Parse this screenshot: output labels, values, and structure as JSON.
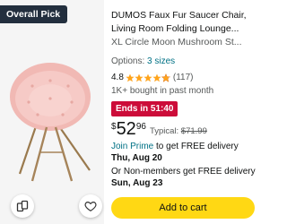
{
  "badge": {
    "label": "Overall Pick"
  },
  "product": {
    "title_line1": "DUMOS Faux Fur Saucer Chair,",
    "title_line2": "Living Room Folding Lounge...",
    "title_line3": "XL Circle Moon Mushroom St...",
    "options_prefix": "Options:",
    "options_link": "3 sizes",
    "rating": "4.8",
    "rating_value": 4.8,
    "review_count": "(117)",
    "bought": "1K+ bought in past month",
    "deal": "Ends in 51:40",
    "price_symbol": "$",
    "price_whole": "52",
    "price_fraction": "96",
    "typical_label": "Typical:",
    "typical_price": "$71.99",
    "delivery_link": "Join Prime",
    "delivery_text": " to get FREE delivery ",
    "delivery_date": "Thu, Aug 20",
    "delivery2_text": "Or Non-members get FREE delivery",
    "delivery2_date": "Sun, Aug 23"
  },
  "actions": {
    "add_to_cart": "Add to cart",
    "compare_icon": "compare-icon",
    "wishlist_icon": "heart-icon"
  },
  "colors": {
    "badge_bg": "#232f3e",
    "star": "#ffa41c",
    "link": "#007185",
    "deal_bg": "#cc0c39",
    "cart_button": "#ffd814",
    "chair_pink": "#f4c7c3"
  }
}
